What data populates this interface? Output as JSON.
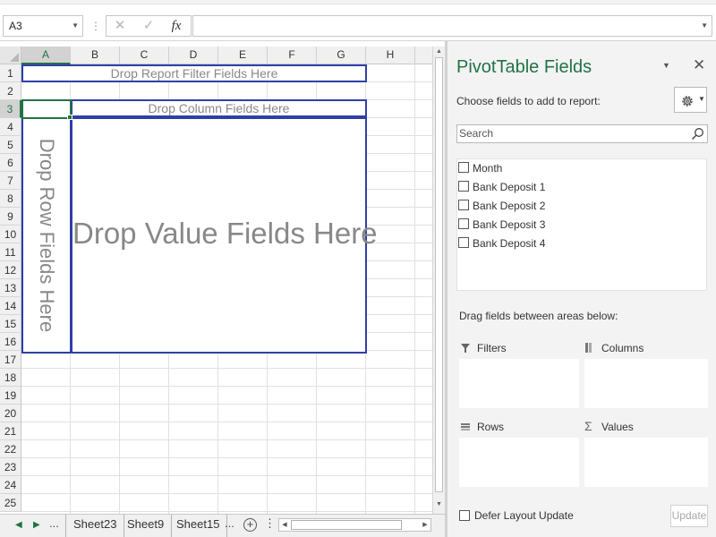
{
  "formula_bar": {
    "name_box": "A3",
    "separator": "⋮",
    "cancel_glyph": "✕",
    "enter_glyph": "✓",
    "fx_label": "fx",
    "formula_value": ""
  },
  "grid": {
    "columns": [
      "A",
      "B",
      "C",
      "D",
      "E",
      "F",
      "G",
      "H"
    ],
    "rows": [
      "1",
      "2",
      "3",
      "4",
      "5",
      "6",
      "7",
      "8",
      "9",
      "10",
      "11",
      "12",
      "13",
      "14",
      "15",
      "16",
      "17",
      "18",
      "19",
      "20",
      "21",
      "22",
      "23",
      "24",
      "25"
    ],
    "selected_cell": "A3",
    "pivot": {
      "report_filter": "Drop Report Filter Fields Here",
      "column_fields": "Drop Column Fields Here",
      "row_fields": "Drop Row Fields Here",
      "value_fields": "Drop Value Fields Here"
    }
  },
  "sheet_tabs": {
    "ellipsis_left": "...",
    "ellipsis_right": "...",
    "tabs": [
      "Sheet23",
      "Sheet9",
      "Sheet15"
    ],
    "add_glyph": "+"
  },
  "pivot_pane": {
    "title": "PivotTable Fields",
    "choose_label": "Choose fields to add to report:",
    "search_placeholder": "Search",
    "fields": [
      "Month",
      "Bank Deposit 1",
      "Bank Deposit 2",
      "Bank Deposit 3",
      "Bank Deposit 4"
    ],
    "drag_label": "Drag fields between areas below:",
    "areas": {
      "filters": "Filters",
      "columns": "Columns",
      "rows": "Rows",
      "values": "Values"
    },
    "defer_label": "Defer Layout Update",
    "update_label": "Update"
  },
  "colors": {
    "accent_green": "#217346",
    "pivot_border": "#2f3fa8"
  }
}
